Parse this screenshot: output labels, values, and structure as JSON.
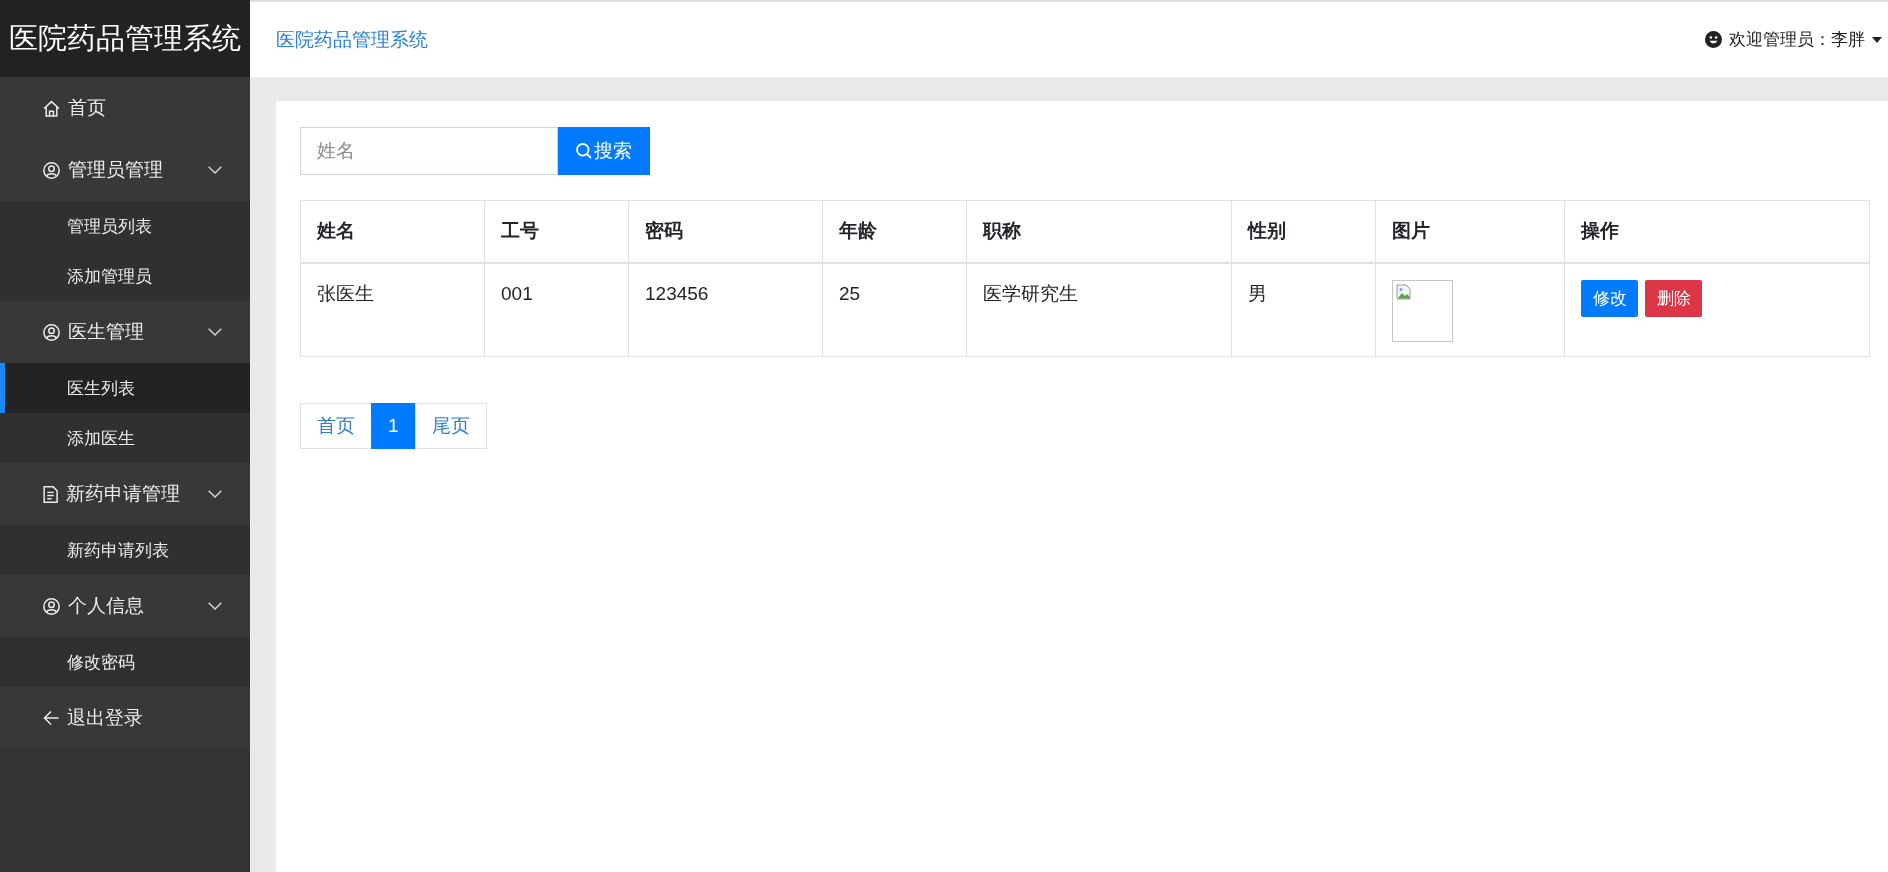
{
  "sidebar": {
    "title": "医院药品管理系统",
    "menu": [
      {
        "kind": "link",
        "label": "首页"
      },
      {
        "kind": "group",
        "label": "管理员管理",
        "expanded": true,
        "children": [
          {
            "label": "管理员列表",
            "selected": false
          },
          {
            "label": "添加管理员",
            "selected": false
          }
        ]
      },
      {
        "kind": "group",
        "label": "医生管理",
        "expanded": true,
        "children": [
          {
            "label": "医生列表",
            "selected": true
          },
          {
            "label": "添加医生",
            "selected": false
          }
        ]
      },
      {
        "kind": "group",
        "label": "新药申请管理",
        "expanded": true,
        "children": [
          {
            "label": "新药申请列表",
            "selected": false
          }
        ]
      },
      {
        "kind": "group",
        "label": "个人信息",
        "expanded": true,
        "children": [
          {
            "label": "修改密码",
            "selected": false
          }
        ]
      },
      {
        "kind": "link",
        "label": "退出登录"
      }
    ]
  },
  "header": {
    "brand": "医院药品管理系统",
    "user_menu": "欢迎管理员：李胖"
  },
  "search": {
    "placeholder": "姓名",
    "button": "搜索"
  },
  "table": {
    "columns": [
      "姓名",
      "工号",
      "密码",
      "年龄",
      "职称",
      "性别",
      "图片",
      "操作"
    ],
    "rows": [
      {
        "cells": [
          {
            "kind": "text",
            "text": "张医生"
          },
          {
            "kind": "text",
            "text": "001"
          },
          {
            "kind": "text",
            "text": "123456"
          },
          {
            "kind": "text",
            "text": "25"
          },
          {
            "kind": "text",
            "text": "医学研究生"
          },
          {
            "kind": "text",
            "text": "男"
          },
          {
            "kind": "image"
          },
          {
            "kind": "actions",
            "buttons": [
              {
                "kind": "edit",
                "label": "修改"
              },
              {
                "kind": "delete",
                "label": "删除"
              }
            ]
          }
        ]
      }
    ]
  },
  "pagination": [
    {
      "label": "首页",
      "selected": false
    },
    {
      "label": "1",
      "selected": true
    },
    {
      "label": "尾页",
      "selected": false
    }
  ]
}
